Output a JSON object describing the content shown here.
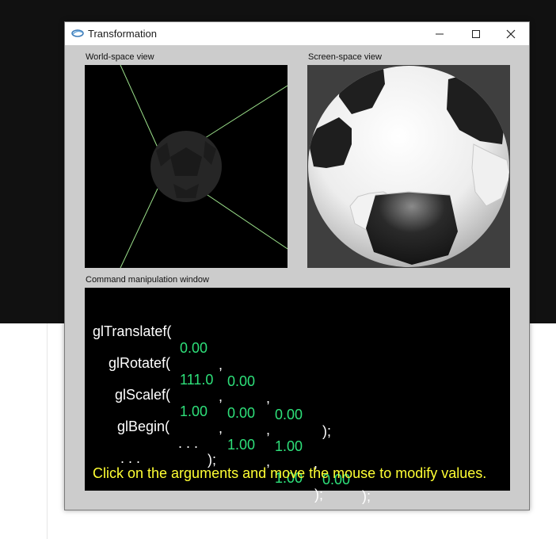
{
  "window": {
    "title": "Transformation",
    "icon": "opengl-app-icon"
  },
  "titlebar_controls": {
    "minimize": "minimize-icon",
    "maximize": "maximize-icon",
    "close": "close-icon"
  },
  "labels": {
    "world": "World-space view",
    "screen": "Screen-space view",
    "command": "Command manipulation window"
  },
  "commands": {
    "translate": {
      "name": "glTranslatef(",
      "args": [
        "0.00",
        "0.00",
        "0.00"
      ],
      "end": ");"
    },
    "rotate": {
      "name": "glRotatef(",
      "args": [
        "111.0",
        "0.00",
        "1.00",
        "0.00"
      ],
      "end": ");"
    },
    "scale": {
      "name": "glScalef(",
      "args": [
        "1.00",
        "1.00",
        "1.00"
      ],
      "end": ");"
    },
    "begin": {
      "name": "glBegin(",
      "body": ". . .",
      "end": ");"
    },
    "ellipsis": ". . .",
    "comma": ","
  },
  "hint": "Click on the arguments and move the mouse to modify values.",
  "colors": {
    "argument": "#2ee07a",
    "hint": "#ffff33",
    "frustum": "#9be08a"
  }
}
